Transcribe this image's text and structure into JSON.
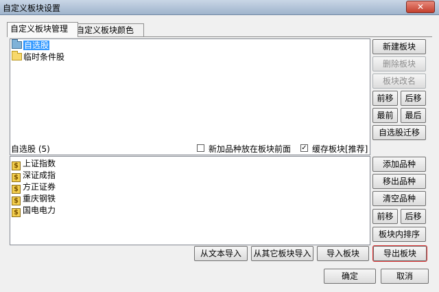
{
  "window": {
    "title": "自定义板块设置",
    "close_label": "✕"
  },
  "tabs": [
    {
      "label": "自定义板块管理"
    },
    {
      "label": "自定义板块颜色"
    }
  ],
  "blocks": {
    "items": [
      {
        "label": "自选股"
      },
      {
        "label": "临时条件股"
      }
    ]
  },
  "block_buttons": {
    "new": "新建板块",
    "delete": "删除板块",
    "rename": "板块改名",
    "move_up": "前移",
    "move_down": "后移",
    "first": "最前",
    "last": "最后",
    "migrate": "自选股迁移"
  },
  "stock_section": {
    "header": "自选股 (5)",
    "add_front_label": "新加品种放在板块前面",
    "add_front_checked": false,
    "cache_label": "缓存板块[推荐]",
    "cache_checked": true,
    "stocks": [
      {
        "label": "上证指数"
      },
      {
        "label": "深证成指"
      },
      {
        "label": "方正证券"
      },
      {
        "label": "重庆钢铁"
      },
      {
        "label": "国电电力"
      }
    ]
  },
  "stock_buttons": {
    "add": "添加品种",
    "export": "移出品种",
    "clear": "清空品种",
    "move_up": "前移",
    "move_down": "后移",
    "sort": "板块内排序"
  },
  "bottom_buttons": {
    "import_text": "从文本导入",
    "import_other": "从其它板块导入",
    "import_block": "导入板块",
    "export_block": "导出板块",
    "ok": "确定",
    "cancel": "取消"
  },
  "colors": {
    "selection": "#3399ff",
    "focus_outline": "#e03030"
  }
}
